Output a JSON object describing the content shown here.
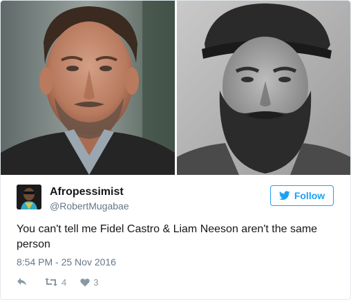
{
  "tweet": {
    "display_name": "Afropessimist",
    "handle": "@RobertMugabae",
    "follow_label": "Follow",
    "text": "You can't tell me Fidel Castro & Liam Neeson aren't the same person",
    "timestamp": "8:54 PM - 25 Nov 2016",
    "retweet_count": "4",
    "like_count": "3"
  },
  "icons": {
    "follow": "twitter-bird-icon",
    "reply": "reply-arrow-icon",
    "retweet": "retweet-icon",
    "like": "heart-icon"
  },
  "colors": {
    "accent": "#1da1f2",
    "text": "#14171a",
    "secondary": "#657786",
    "action": "#8899a6"
  }
}
